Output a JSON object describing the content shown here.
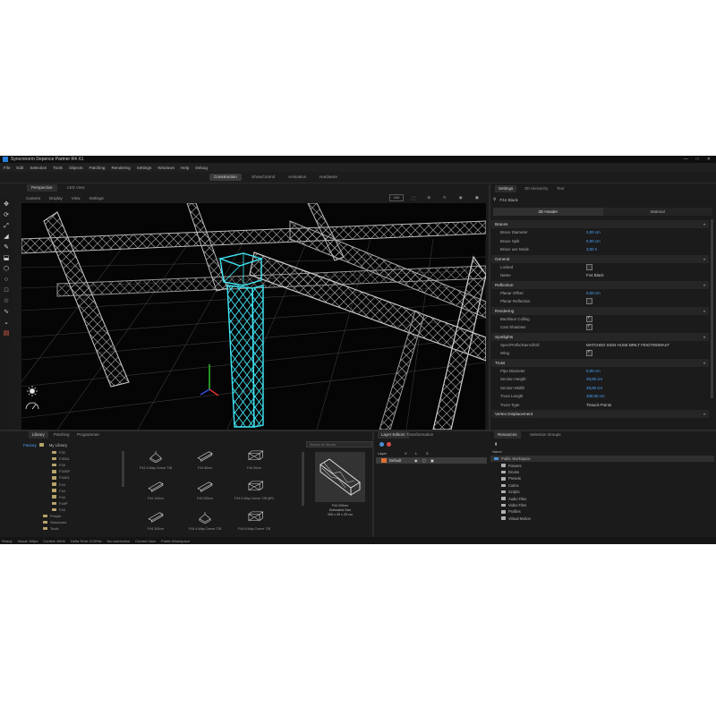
{
  "app": {
    "title": "Syncronorm Depence Partner R4 X1",
    "window_controls": [
      "—",
      "□",
      "✕"
    ]
  },
  "menu": [
    "File",
    "Edit",
    "Selection",
    "Tools",
    "Objects",
    "Patching",
    "Rendering",
    "Settings",
    "Windows",
    "Help",
    "Debug"
  ],
  "mode_tabs": [
    {
      "label": "Construction",
      "active": true
    },
    {
      "label": "ShowControl",
      "active": false
    },
    {
      "label": "Animation",
      "active": false
    },
    {
      "label": "Hardware",
      "active": false
    }
  ],
  "left_tools": [
    "move-icon",
    "rotate-icon",
    "scale-icon",
    "measure-icon",
    "pen-icon",
    "paint-icon",
    "cube-icon",
    "circle-icon",
    "square-icon",
    "star-icon",
    "path-icon",
    "chevron-icon",
    "light-icon"
  ],
  "viewport": {
    "tabs": [
      {
        "label": "Perspective",
        "active": true
      },
      {
        "label": "LED View",
        "active": false
      }
    ],
    "menu": [
      "Camera",
      "Display",
      "View",
      "Settings"
    ],
    "zoom": "100"
  },
  "right_panel": {
    "tabs": [
      {
        "label": "Settings",
        "active": true
      },
      {
        "label": "3D Hierarchy",
        "active": false
      },
      {
        "label": "Text",
        "active": false
      }
    ],
    "object_name": "F44 Black",
    "subtabs": [
      {
        "label": "3D Header",
        "active": true
      },
      {
        "label": "Material",
        "active": false
      }
    ],
    "sections": [
      {
        "title": "Braces",
        "rows": [
          {
            "label": "Brace Diameter",
            "value": "2,00 cm",
            "type": "num"
          },
          {
            "label": "Brace Split",
            "value": "0,00 cm",
            "type": "num"
          },
          {
            "label": "Brace use Mode",
            "value": "3,00 n",
            "type": "num"
          }
        ]
      },
      {
        "title": "General",
        "rows": [
          {
            "label": "Locked",
            "value": "",
            "type": "check",
            "checked": false
          },
          {
            "label": "Name",
            "value": "F44 Black",
            "type": "text"
          }
        ]
      },
      {
        "title": "Reflection",
        "rows": [
          {
            "label": "Planar Offset",
            "value": "0,00 cm",
            "type": "num"
          },
          {
            "label": "Planar Reflection",
            "value": "",
            "type": "check",
            "checked": false
          }
        ]
      },
      {
        "title": "Rendering",
        "rows": [
          {
            "label": "Backface Culling",
            "value": "",
            "type": "check",
            "checked": true
          },
          {
            "label": "Cast Shadows",
            "value": "",
            "type": "check",
            "checked": true
          }
        ]
      },
      {
        "title": "Spotlights",
        "rows": [
          {
            "label": "Spec/Prefix/Stencil/Gil",
            "value": "MATCHED SIGN HUSE BRILT FEIGTMOMAnT",
            "type": "text"
          },
          {
            "label": "Wing",
            "value": "",
            "type": "check",
            "checked": true
          }
        ]
      },
      {
        "title": "Truss",
        "rows": [
          {
            "label": "Pipe Diameter",
            "value": "5,00 cm",
            "type": "num"
          },
          {
            "label": "Section Height",
            "value": "29,00 cm",
            "type": "num"
          },
          {
            "label": "Section Width",
            "value": "29,00 cm",
            "type": "num"
          },
          {
            "label": "Truss Length",
            "value": "400,00 cm",
            "type": "num"
          },
          {
            "label": "Truss Type",
            "value": "Tissuck Points",
            "type": "text"
          }
        ]
      },
      {
        "title": "Vertex Displacement",
        "rows": []
      }
    ]
  },
  "bottom": {
    "library_tabs": [
      {
        "label": "Library",
        "active": true
      },
      {
        "label": "Patching",
        "active": false
      },
      {
        "label": "Programmer",
        "active": false
      }
    ],
    "library_header": [
      "Factory",
      "My Library"
    ],
    "tree": [
      "F32",
      "F32DL",
      "F34",
      "F34SP",
      "F34DL",
      "F44",
      "F44",
      "F44",
      "F44P",
      "F44",
      "Prolyte",
      "Structures",
      "Tools"
    ],
    "search_placeholder": "Search for library",
    "items": [
      {
        "label": "F44 4-Way Corner T/B",
        "shape": "corner"
      },
      {
        "label": "F44 50cm",
        "shape": "beam"
      },
      {
        "label": "F44 50cm",
        "shape": "box"
      },
      {
        "label": "F44 100cm",
        "shape": "beam"
      },
      {
        "label": "F44 200cm",
        "shape": "beam"
      },
      {
        "label": "F44 6-Way Corner T/B (6P)",
        "shape": "box"
      },
      {
        "label": "F44 300cm",
        "shape": "beam"
      },
      {
        "label": "F44 4-Way Corner T/B",
        "shape": "corner"
      },
      {
        "label": "F44 6-Way Corner T/B",
        "shape": "box"
      }
    ],
    "preview_caption": [
      "F44 200cm",
      "Estimated Size",
      "200 x 29 x 29 cm"
    ],
    "layers_tabs": [
      {
        "label": "Layer Editors",
        "active": true
      },
      {
        "label": "Transformation",
        "active": false
      }
    ],
    "layers_header": [
      "Layer",
      "V",
      "L",
      "S"
    ],
    "layers": [
      {
        "name": "Default"
      }
    ],
    "workspace_tabs": [
      {
        "label": "Resources",
        "active": true
      },
      {
        "label": "Selection Groups",
        "active": false
      }
    ],
    "workspace_label": "Name",
    "workspace_tree": [
      "Public Workspace",
      "Fixtures",
      "Drums",
      "Presets",
      "Cutins",
      "Scripts",
      "Audio Files",
      "Video Files",
      "Profiles",
      "Virtual Motion"
    ]
  },
  "statusbar": [
    "Ready",
    "Visual: 60fps",
    "Control: 60Hz",
    "Delta Time: 0.00%s",
    "No connection",
    "Current User",
    "Public Workspace"
  ]
}
